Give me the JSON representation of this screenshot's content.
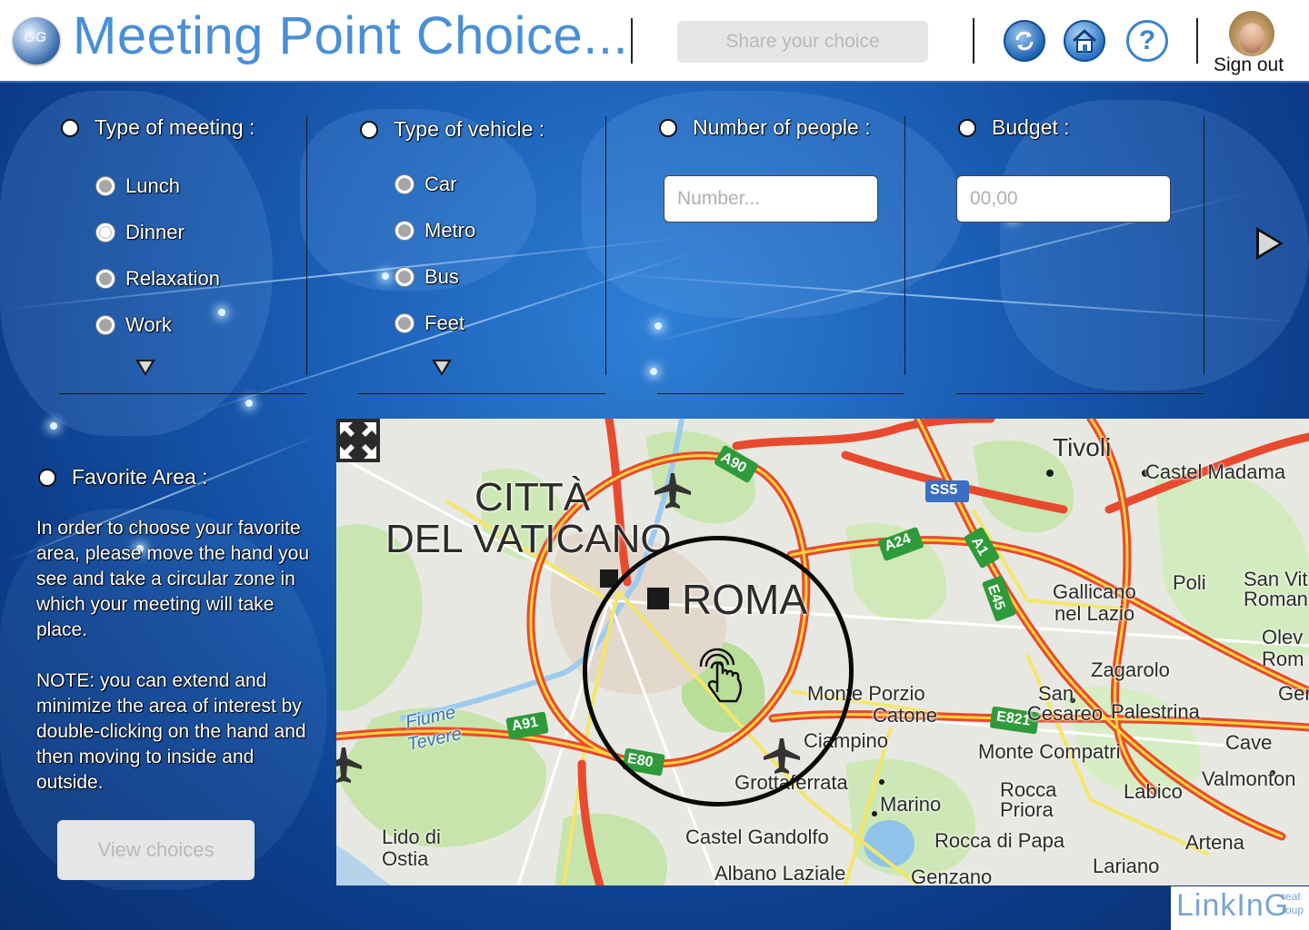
{
  "header": {
    "title": "Meeting Point Choice...",
    "logo_text": "GG",
    "share_label": "Share your choice",
    "help_glyph": "?",
    "signout_label": "Sign out"
  },
  "filters": {
    "meeting": {
      "label": "Type of meeting :",
      "options": [
        "Lunch",
        "Dinner",
        "Relaxation",
        "Work"
      ]
    },
    "vehicle": {
      "label": "Type of vehicle :",
      "options": [
        "Car",
        "Metro",
        "Bus",
        "Feet"
      ]
    },
    "people": {
      "label": "Number of people :",
      "placeholder": "Number..."
    },
    "budget": {
      "label": "Budget :",
      "placeholder": "00,00"
    }
  },
  "favorite": {
    "label": "Favorite Area :",
    "description": "In order to choose your favorite area, please move the hand you see and take a circular zone in which your meeting will take place.",
    "note": "NOTE: you can extend and minimize the area of interest by double-clicking on the hand and then moving to inside and outside.",
    "view_button": "View choices"
  },
  "map": {
    "labels": {
      "citta": "CITTÀ",
      "vaticano": "DEL VATICANO",
      "roma": "ROMA",
      "tivoli": "Tivoli",
      "castel_madama": "Castel Madama",
      "gallicano": "Gallicano",
      "nel_lazio": "nel Lazio",
      "poli": "Poli",
      "san_vito": "San Vit",
      "romano": "Roman",
      "olevano": "Olev",
      "olevano2": "Rom",
      "zagarolo": "Zagarolo",
      "san": "San",
      "cesareo": "Cesareo",
      "palestrina": "Palestrina",
      "gen": "Gen",
      "monte_porzio": "Monte Porzio",
      "catone": "Catone",
      "ciampino": "Ciampino",
      "monte_compatri": "Monte Compatri",
      "cave": "Cave",
      "valmontone": "Valmonton",
      "grottaferrata": "Grottaferrata",
      "rocca": "Rocca",
      "priora": "Priora",
      "labico": "Labico",
      "marino": "Marino",
      "fiume": "Fiume",
      "tevere": "Tevere",
      "lido": "Lido di",
      "ostia": "Ostia",
      "castel_gandolfo": "Castel Gandolfo",
      "rocca_papa": "Rocca di Papa",
      "artena": "Artena",
      "albano": "Albano Laziale",
      "genzano": "Genzano",
      "lariano": "Lariano"
    },
    "road_shields": {
      "a90": "A90",
      "ss5": "SS5",
      "a24": "A24",
      "a1": "A1",
      "e45": "E45",
      "a91": "A91",
      "e80": "E80",
      "e821": "E821"
    }
  },
  "brand": {
    "name": "LinkInG",
    "sub1": "reat",
    "sub2": "roup"
  }
}
